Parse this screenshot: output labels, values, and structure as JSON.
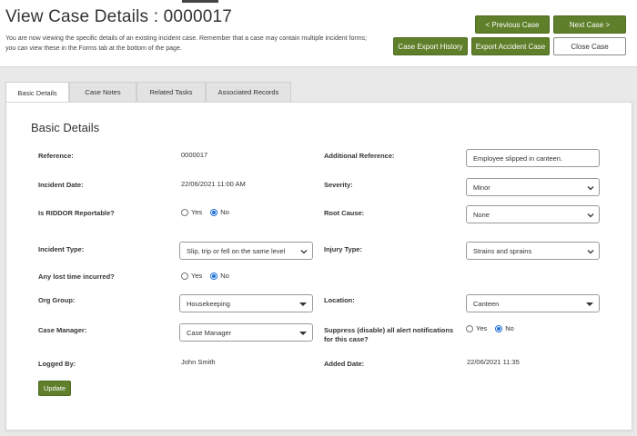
{
  "header": {
    "title": "View Case Details : 0000017",
    "intro": "You are now viewing the specific details of an existing incident case. Remember that a case may contain multiple incident forms; you can view these in the Forms tab at the bottom of the page.",
    "prev_label": "< Previous Case",
    "next_label": "Next Case >",
    "export_history_label": "Case Export History",
    "export_accident_label": "Export Accident Case",
    "close_label": "Close Case"
  },
  "tabs": [
    {
      "label": "Basic Details",
      "active": true
    },
    {
      "label": "Case Notes",
      "active": false
    },
    {
      "label": "Related Tasks",
      "active": false
    },
    {
      "label": "Associated Records",
      "active": false
    }
  ],
  "section_title": "Basic Details",
  "fields": {
    "reference": {
      "label": "Reference:",
      "value": "0000017"
    },
    "additional_reference": {
      "label": "Additional Reference:",
      "value": "Employee slipped in canteen."
    },
    "incident_date": {
      "label": "Incident Date:",
      "value": "22/06/2021 11:00 AM"
    },
    "severity": {
      "label": "Severity:",
      "value": "Minor"
    },
    "riddor": {
      "label": "Is RIDDOR Reportable?",
      "yes": "Yes",
      "no": "No",
      "selected": "No"
    },
    "root_cause": {
      "label": "Root Cause:",
      "value": "None"
    },
    "incident_type": {
      "label": "Incident Type:",
      "value": "Slip, trip or fell on the same level"
    },
    "injury_type": {
      "label": "Injury Type:",
      "value": "Strains and sprains"
    },
    "lost_time": {
      "label": "Any lost time incurred?",
      "yes": "Yes",
      "no": "No",
      "selected": "No"
    },
    "org_group": {
      "label": "Org Group:",
      "value": "Housekeeping"
    },
    "location": {
      "label": "Location:",
      "value": "Canteen"
    },
    "case_manager": {
      "label": "Case Manager:",
      "value": "Case Manager"
    },
    "suppress_alerts": {
      "label": "Suppress (disable) all alert notifications for this case?",
      "yes": "Yes",
      "no": "No",
      "selected": "No"
    },
    "logged_by": {
      "label": "Logged By:",
      "value": "John Smith"
    },
    "added_date": {
      "label": "Added Date:",
      "value": "22/06/2021 11:35"
    }
  },
  "update_label": "Update",
  "colors": {
    "primary_green": "#5f7f2a",
    "radio_blue": "#1f6fd6"
  }
}
